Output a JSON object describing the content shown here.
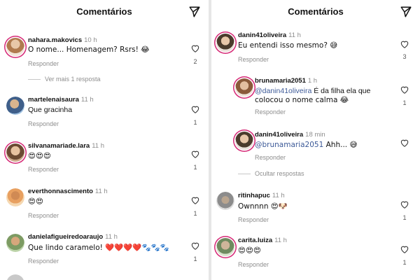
{
  "header": {
    "title": "Comentários"
  },
  "left": {
    "comments": [
      {
        "username": "nahara.makovics",
        "time": "10 h",
        "text": "O nome... Homenagem? Rsrs! 😂",
        "reply": "Responder",
        "likes": "2"
      },
      {
        "username": "martelenaisaura",
        "time": "11 h",
        "text": "Que gracinha",
        "reply": "Responder",
        "likes": "1"
      },
      {
        "username": "silvanamariade.lara",
        "time": "11 h",
        "text": "😍😍😍",
        "reply": "Responder",
        "likes": "1"
      },
      {
        "username": "everthonnascimento",
        "time": "11 h",
        "text": "😍😍",
        "reply": "Responder",
        "likes": "1"
      },
      {
        "username": "danielafigueiredoaraujo",
        "time": "11 h",
        "text": "Que lindo caramelo! ❤️❤️❤️❤️🐾🐾🐾",
        "reply": "Responder",
        "likes": "1"
      }
    ],
    "more_replies": "Ver mais 1 resposta"
  },
  "right": {
    "comments": [
      {
        "username": "danin41oliveira",
        "time": "11 h",
        "text": "Eu entendi isso mesmo? 😅",
        "reply": "Responder",
        "likes": "3"
      },
      {
        "username": "ritinhapuc",
        "time": "11 h",
        "text": "Ownnnn 😍🐶",
        "reply": "Responder",
        "likes": "1"
      },
      {
        "username": "carita.luiza",
        "time": "11 h",
        "text": "😍😍😍",
        "reply": "Responder",
        "likes": "1"
      }
    ],
    "replies": [
      {
        "username": "brunamaria2051",
        "time": "1 h",
        "mention": "@danin41oliveira",
        "text_line1": " É da filha ela que",
        "text_line2": "colocou o nome calma 😂",
        "reply": "Responder",
        "likes": "1"
      },
      {
        "username": "danin41oliveira",
        "time": "18 min",
        "mention": "@brunamaria2051",
        "text": " Ahh... 😅",
        "reply": "Responder",
        "likes": ""
      }
    ],
    "hide_replies": "Ocultar respostas"
  }
}
